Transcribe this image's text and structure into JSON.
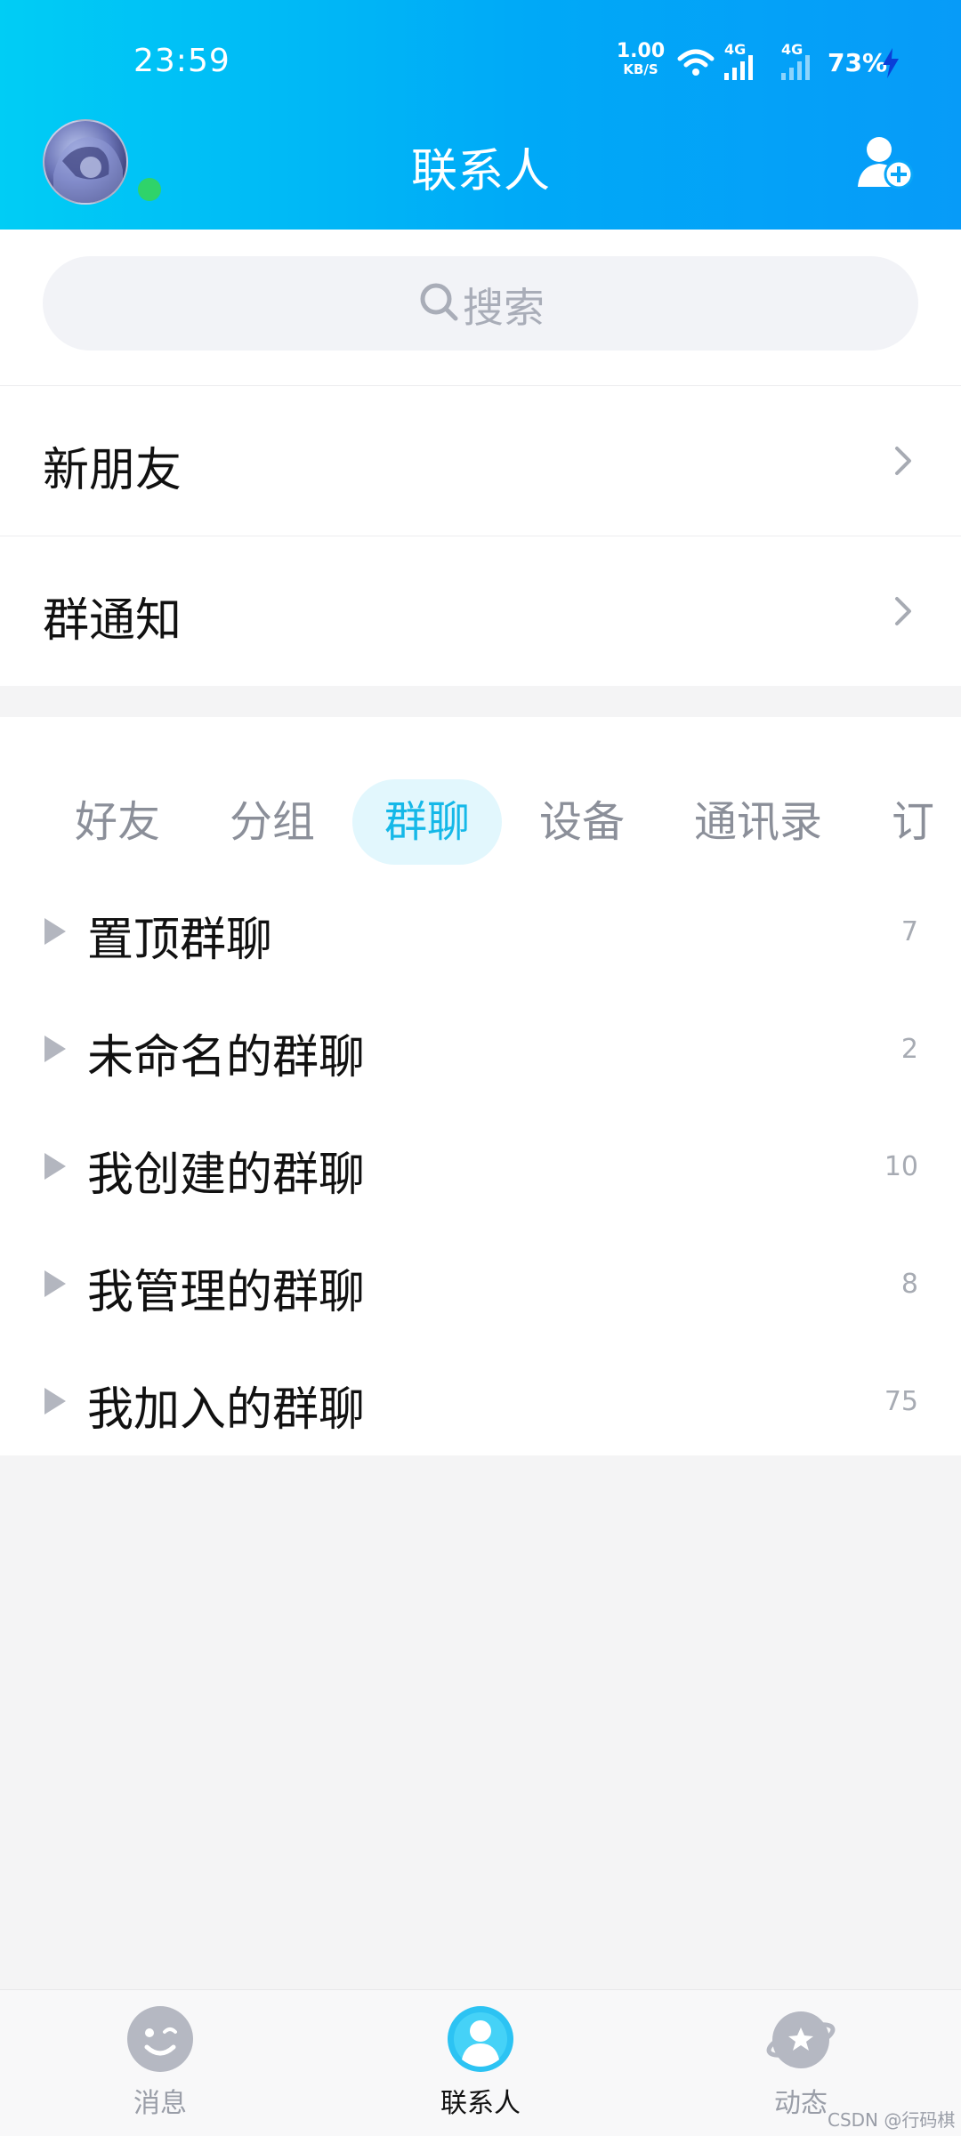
{
  "status_bar": {
    "time": "23:59",
    "net_speed_value": "1.00",
    "net_speed_unit": "KB/S",
    "network_1": "4G",
    "network_2": "4G",
    "battery": "73%"
  },
  "header": {
    "title": "联系人"
  },
  "search": {
    "placeholder": "搜索"
  },
  "menu": {
    "new_friends": "新朋友",
    "group_notice": "群通知"
  },
  "tabs": [
    "好友",
    "分组",
    "群聊",
    "设备",
    "通讯录",
    "订阅"
  ],
  "active_tab": "群聊",
  "groups": [
    {
      "name": "置顶群聊",
      "count": "7"
    },
    {
      "name": "未命名的群聊",
      "count": "2"
    },
    {
      "name": "我创建的群聊",
      "count": "10"
    },
    {
      "name": "我管理的群聊",
      "count": "8"
    },
    {
      "name": "我加入的群聊",
      "count": "75"
    }
  ],
  "bottom_nav": {
    "messages": "消息",
    "contacts": "联系人",
    "moments": "动态"
  },
  "watermark": "CSDN @行码棋",
  "colors": {
    "header_start": "#00cdf5",
    "header_end": "#079bf8",
    "accent": "#15b8e8",
    "online": "#2fd36a"
  }
}
